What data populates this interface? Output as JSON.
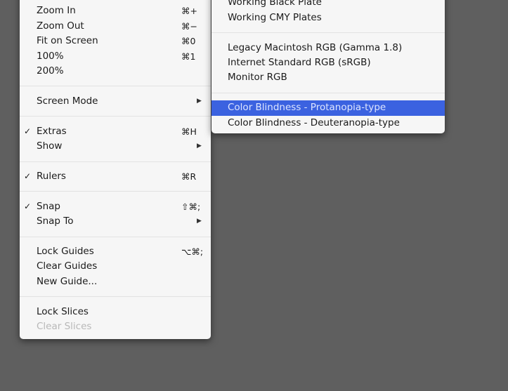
{
  "view_menu": {
    "items": [
      {
        "label": "Zoom In",
        "shortcut": "⌘+"
      },
      {
        "label": "Zoom Out",
        "shortcut": "⌘−"
      },
      {
        "label": "Fit on Screen",
        "shortcut": "⌘0"
      },
      {
        "label": "100%",
        "shortcut": "⌘1"
      },
      {
        "label": "200%"
      },
      {
        "label": "Screen Mode",
        "submenu": true
      },
      {
        "label": "Extras",
        "shortcut": "⌘H",
        "checked": true
      },
      {
        "label": "Show",
        "submenu": true
      },
      {
        "label": "Rulers",
        "shortcut": "⌘R",
        "checked": true
      },
      {
        "label": "Snap",
        "shortcut": "⇧⌘;",
        "checked": true
      },
      {
        "label": "Snap To",
        "submenu": true
      },
      {
        "label": "Lock Guides",
        "shortcut": "⌥⌘;"
      },
      {
        "label": "Clear Guides"
      },
      {
        "label": "New Guide..."
      },
      {
        "label": "Lock Slices"
      },
      {
        "label": "Clear Slices",
        "disabled": true
      }
    ],
    "check_mark": "✓",
    "submenu_arrow": "▶"
  },
  "proof_setup_submenu": {
    "items": [
      {
        "label": "Working Black Plate"
      },
      {
        "label": "Working CMY Plates"
      },
      {
        "label": "Legacy Macintosh RGB (Gamma 1.8)"
      },
      {
        "label": "Internet Standard RGB (sRGB)"
      },
      {
        "label": "Monitor RGB"
      },
      {
        "label": "Color Blindness - Protanopia-type",
        "highlighted": true
      },
      {
        "label": "Color Blindness - Deuteranopia-type"
      }
    ]
  },
  "colors": {
    "background": "#5f5f5f",
    "menu": "#f6f6f6",
    "highlight": "#3b62e0"
  }
}
